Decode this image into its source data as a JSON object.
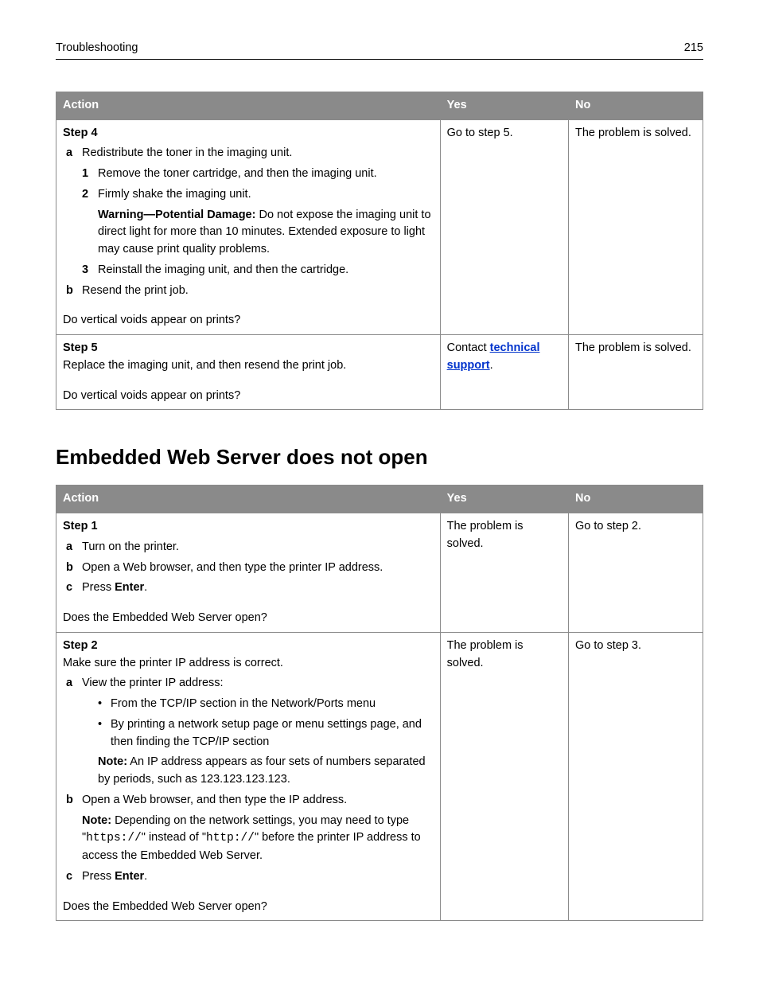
{
  "header": {
    "section": "Troubleshooting",
    "page": "215"
  },
  "table1": {
    "colAction": "Action",
    "colYes": "Yes",
    "colNo": "No",
    "rows": [
      {
        "step": "Step 4",
        "a_marker": "a",
        "a_text": "Redistribute the toner in the imaging unit.",
        "n1_marker": "1",
        "n1_text": "Remove the toner cartridge, and then the imaging unit.",
        "n2_marker": "2",
        "n2_text": "Firmly shake the imaging unit.",
        "warn_label": "Warning—Potential Damage:",
        "warn_text": " Do not expose the imaging unit to direct light for more than 10 minutes. Extended exposure to light may cause print quality problems.",
        "n3_marker": "3",
        "n3_text": "Reinstall the imaging unit, and then the cartridge.",
        "b_marker": "b",
        "b_text": "Resend the print job.",
        "question": "Do vertical voids appear on prints?",
        "yes": "Go to step 5.",
        "no": "The problem is solved."
      },
      {
        "step": "Step 5",
        "body": "Replace the imaging unit, and then resend the print job.",
        "question": "Do vertical voids appear on prints?",
        "yes_pre": "Contact ",
        "yes_link": "technical support",
        "yes_post": ".",
        "no": "The problem is solved."
      }
    ]
  },
  "section2_title": "Embedded Web Server does not open",
  "table2": {
    "colAction": "Action",
    "colYes": "Yes",
    "colNo": "No",
    "rows": [
      {
        "step": "Step 1",
        "a_marker": "a",
        "a_text": "Turn on the printer.",
        "b_marker": "b",
        "b_text": "Open a Web browser, and then type the printer IP address.",
        "c_marker": "c",
        "c_pre": "Press ",
        "c_bold": "Enter",
        "c_post": ".",
        "question": "Does the Embedded Web Server open?",
        "yes": "The problem is solved.",
        "no": "Go to step 2."
      },
      {
        "step": "Step 2",
        "intro": "Make sure the printer IP address is correct.",
        "a_marker": "a",
        "a_text": "View the printer IP address:",
        "bul1": "From the TCP/IP section in the Network/Ports menu",
        "bul2": "By printing a network setup page or menu settings page, and then finding the TCP/IP section",
        "note1_label": "Note:",
        "note1_text": " An IP address appears as four sets of numbers separated by periods, such as 123.123.123.123.",
        "b_marker": "b",
        "b_text": "Open a Web browser, and then type the IP address.",
        "note2_label": "Note:",
        "note2_pre": " Depending on the network settings, you may need to type \"",
        "note2_code1": "https://",
        "note2_mid": "\" instead of \"",
        "note2_code2": "http://",
        "note2_post": "\" before the printer IP address to access the Embedded Web Server.",
        "c_marker": "c",
        "c_pre": "Press ",
        "c_bold": "Enter",
        "c_post": ".",
        "question": "Does the Embedded Web Server open?",
        "yes": "The problem is solved.",
        "no": "Go to step 3."
      }
    ]
  }
}
